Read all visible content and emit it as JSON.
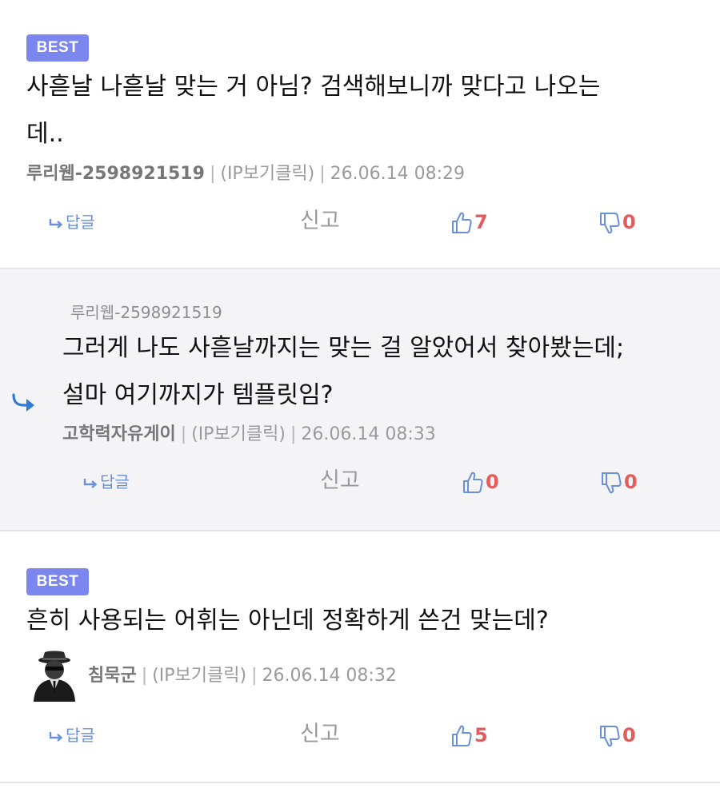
{
  "comments": [
    {
      "badge": "BEST",
      "body": "사흗날 나흗날 맞는 거 아님? 검색해보니까 맞다고 나오는\n데..",
      "author": "루리웹-2598921519",
      "ip_label": "(IP보기클릭)",
      "date": "26.06.14 08:29",
      "reply_label": "답글",
      "report_label": "신고",
      "likes": "7",
      "dislikes": "0"
    },
    {
      "parent_author": "루리웹-2598921519",
      "body": "그러게 나도 사흗날까지는 맞는 걸 알았어서 찾아봤는데;\n설마 여기까지가 템플릿임?",
      "author": "고학력자유게이",
      "ip_label": "(IP보기클릭)",
      "date": "26.06.14 08:33",
      "reply_label": "답글",
      "report_label": "신고",
      "likes": "0",
      "dislikes": "0"
    },
    {
      "badge": "BEST",
      "body": "흔히 사용되는 어휘는 아닌데 정확하게 쓴건 맞는데?",
      "author": "침묵군",
      "ip_label": "(IP보기클릭)",
      "date": "26.06.14 08:32",
      "reply_label": "답글",
      "report_label": "신고",
      "likes": "5",
      "dislikes": "0"
    }
  ],
  "icons": {
    "reply": "reply-arrow-icon",
    "like": "thumbs-up-icon",
    "dislike": "thumbs-down-icon",
    "nested_reply": "reply-indicator-icon",
    "avatar": "spy-avatar"
  },
  "colors": {
    "best_badge": "#7b86ee",
    "count": "#e45b5b",
    "icon_blue": "#6b8fd9",
    "reply_bg": "#f4f4f6"
  }
}
